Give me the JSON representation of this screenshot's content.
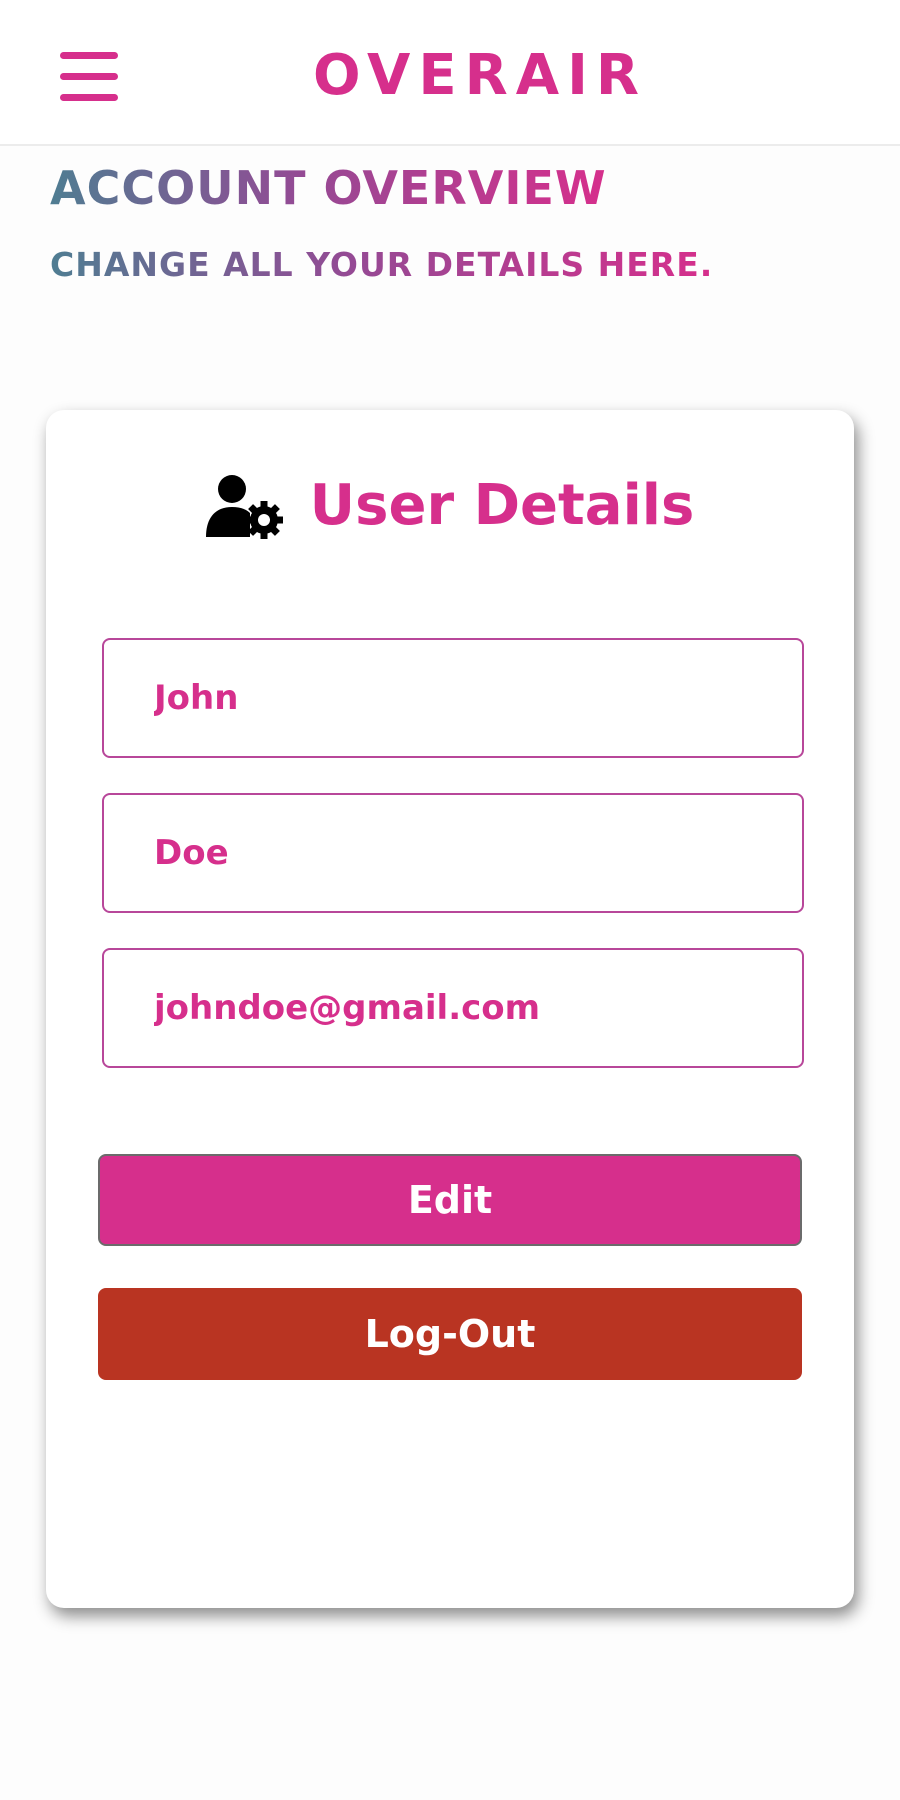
{
  "header": {
    "brand": "OVERAIR",
    "menu_icon": "hamburger-menu-icon"
  },
  "page": {
    "title": "ACCOUNT OVERVIEW",
    "subtitle": "CHANGE ALL YOUR DETAILS HERE."
  },
  "card": {
    "icon": "user-gear-icon",
    "title": "User Details",
    "fields": {
      "first_name": "John",
      "last_name": "Doe",
      "email": "johndoe@gmail.com"
    },
    "edit_label": "Edit",
    "logout_label": "Log-Out"
  },
  "colors": {
    "accent": "#d62f8c",
    "logout": "#b93422",
    "gradient_start": "#4f7d92",
    "gradient_mid": "#944a94",
    "gradient_end": "#d62f8c"
  }
}
